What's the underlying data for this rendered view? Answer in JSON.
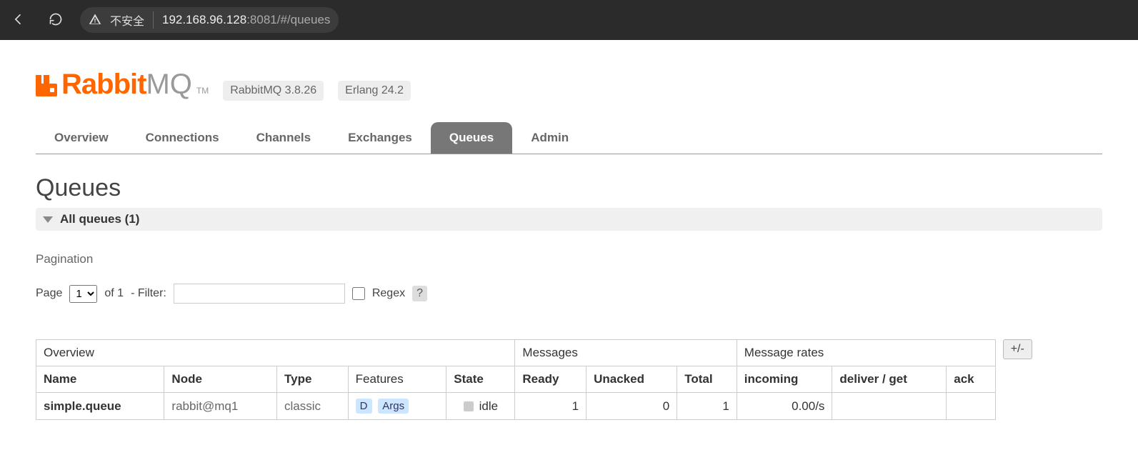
{
  "browser": {
    "insecure_label": "不安全",
    "url_host": "192.168.96.128",
    "url_rest": ":8081/#/queues"
  },
  "header": {
    "logo_rabbit": "Rabbit",
    "logo_mq": "MQ",
    "logo_tm": "TM",
    "version_badge": "RabbitMQ 3.8.26",
    "erlang_badge": "Erlang 24.2"
  },
  "tabs": [
    {
      "label": "Overview",
      "active": false
    },
    {
      "label": "Connections",
      "active": false
    },
    {
      "label": "Channels",
      "active": false
    },
    {
      "label": "Exchanges",
      "active": false
    },
    {
      "label": "Queues",
      "active": true
    },
    {
      "label": "Admin",
      "active": false
    }
  ],
  "page_title": "Queues",
  "section_header": "All queues (1)",
  "pagination_label": "Pagination",
  "controls": {
    "page_label": "Page",
    "page_options": [
      "1"
    ],
    "of_label": "of 1",
    "filter_label": "- Filter:",
    "filter_value": "",
    "regex_label": "Regex",
    "help": "?"
  },
  "table": {
    "group_headers": {
      "overview": "Overview",
      "messages": "Messages",
      "rates": "Message rates"
    },
    "columns": {
      "name": "Name",
      "node": "Node",
      "type": "Type",
      "features": "Features",
      "state": "State",
      "ready": "Ready",
      "unacked": "Unacked",
      "total": "Total",
      "incoming": "incoming",
      "deliver_get": "deliver / get",
      "ack": "ack"
    },
    "rows": [
      {
        "name": "simple.queue",
        "node": "rabbit@mq1",
        "type": "classic",
        "feature_d": "D",
        "feature_args": "Args",
        "state": "idle",
        "ready": "1",
        "unacked": "0",
        "total": "1",
        "incoming": "0.00/s",
        "deliver_get": "",
        "ack": ""
      }
    ],
    "plusminus": "+/-"
  }
}
